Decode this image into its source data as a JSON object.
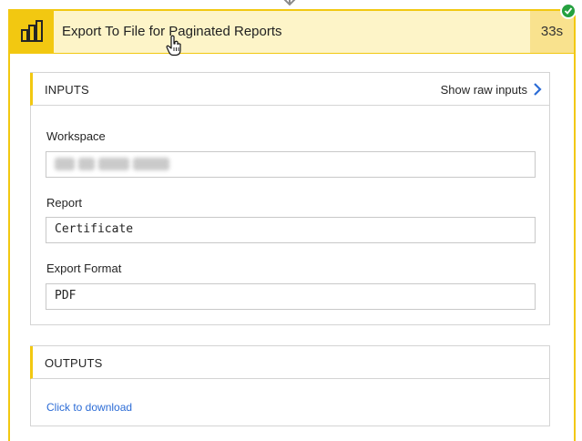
{
  "step": {
    "title": "Export To File for Paginated Reports",
    "duration": "33s",
    "status": "succeeded",
    "icon": "power-bi-icon",
    "accent_color": "#f2c811",
    "success_color": "#25a140"
  },
  "inputs": {
    "section_title": "INPUTS",
    "raw_link": "Show raw inputs",
    "fields": [
      {
        "label": "Workspace",
        "value": ""
      },
      {
        "label": "Report",
        "value": "Certificate"
      },
      {
        "label": "Export Format",
        "value": "PDF"
      }
    ]
  },
  "outputs": {
    "section_title": "OUTPUTS",
    "download_link": "Click to download",
    "link_color": "#2c6cd6"
  }
}
